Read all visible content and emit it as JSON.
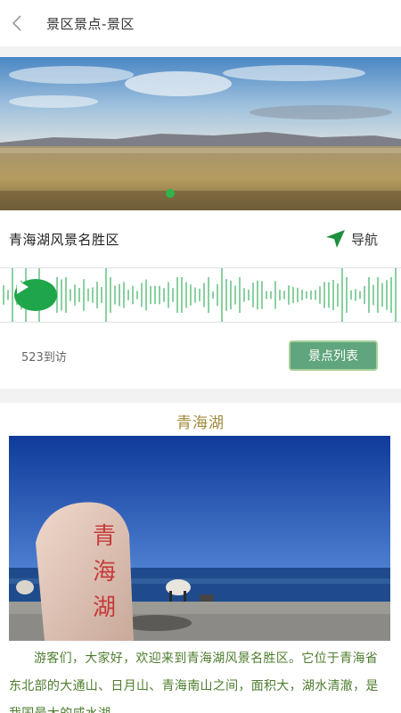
{
  "header": {
    "title": "景区景点-景区",
    "back_icon": "chevron-left-icon"
  },
  "banner": {
    "current_slide": 1,
    "indicator_color": "#2fb44c"
  },
  "place": {
    "name": "青海湖风景名胜区",
    "nav_label": "导航",
    "nav_icon": "navigation-arrow-icon"
  },
  "audio": {
    "play_icon": "play-icon",
    "accent": "#1fa64a"
  },
  "stats": {
    "visits": "523到访",
    "list_button": "景点列表"
  },
  "article": {
    "title": "青海湖",
    "stone_text": "青海湖",
    "paragraph": "游客们，大家好，欢迎来到青海湖风景名胜区。它位于青海省东北部的大通山、日月山、青海南山之间，面积大，湖水清澈，是我国最大的咸水湖。"
  }
}
